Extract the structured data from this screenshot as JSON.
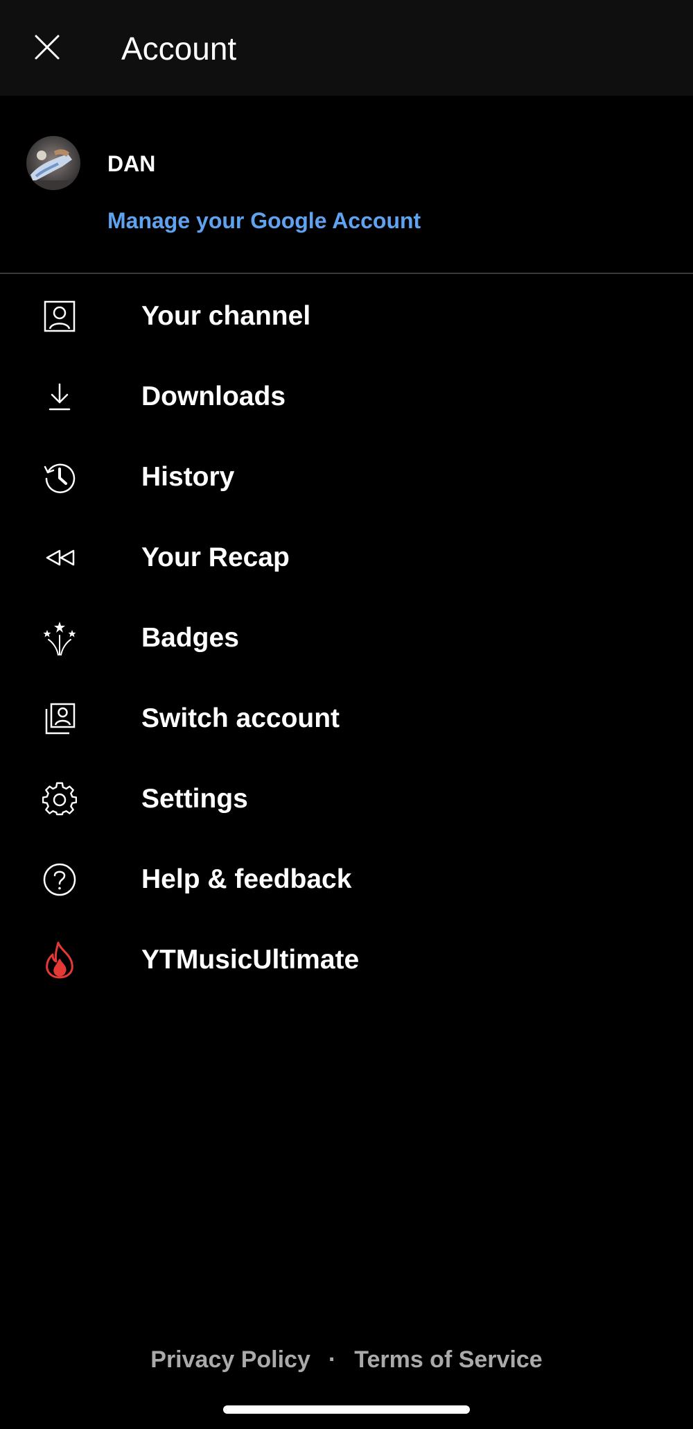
{
  "header": {
    "title": "Account",
    "close_icon": "close-icon"
  },
  "account": {
    "name": "DAN",
    "manage_label": "Manage your Google Account",
    "link_color": "#5fa3f0"
  },
  "menu": {
    "items": [
      {
        "label": "Your channel",
        "icon": "person-box-icon"
      },
      {
        "label": "Downloads",
        "icon": "download-icon"
      },
      {
        "label": "History",
        "icon": "history-icon"
      },
      {
        "label": "Your Recap",
        "icon": "rewind-icon"
      },
      {
        "label": "Badges",
        "icon": "fireworks-icon"
      },
      {
        "label": "Switch account",
        "icon": "switch-account-icon"
      },
      {
        "label": "Settings",
        "icon": "gear-icon"
      },
      {
        "label": "Help & feedback",
        "icon": "help-icon"
      },
      {
        "label": "YTMusicUltimate",
        "icon": "flame-icon",
        "icon_color": "#e53935"
      }
    ]
  },
  "footer": {
    "privacy": "Privacy Policy",
    "separator": "·",
    "terms": "Terms of Service"
  }
}
